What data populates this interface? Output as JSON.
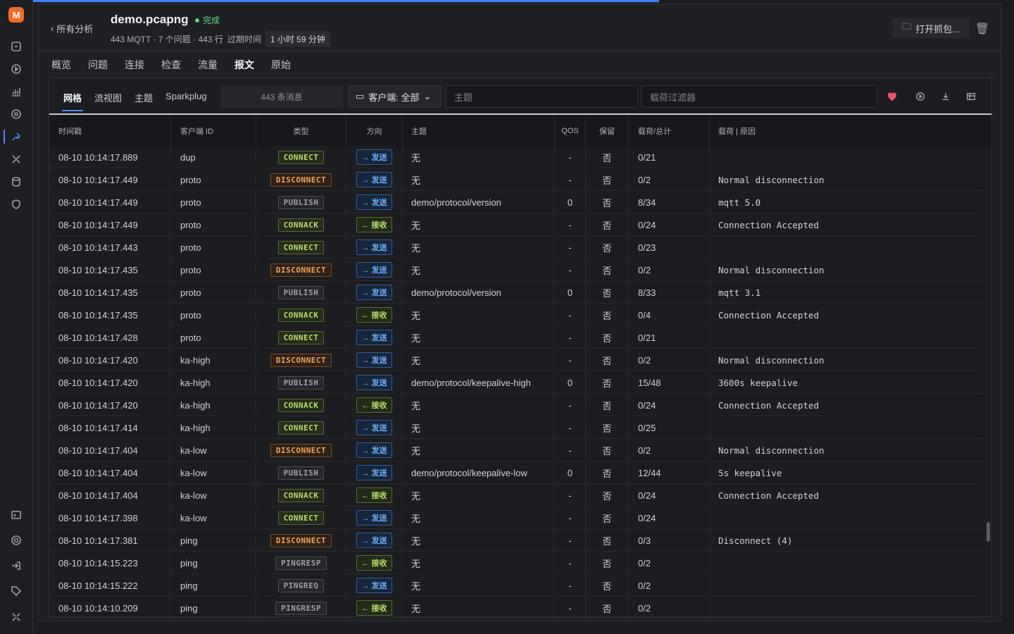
{
  "app": {
    "title": "demo.pcapng",
    "status": "完成",
    "back_label": "所有分析",
    "meta": "443 MQTT · 7 个问题 · 443 行",
    "expire_label": "过期时间",
    "expire_value": "1 小时 59 分钟",
    "open_button": "打开抓包..."
  },
  "tabs": [
    "概览",
    "问题",
    "连接",
    "检查",
    "流量",
    "报文",
    "原始"
  ],
  "active_tab": "报文",
  "subtabs": [
    "网格",
    "流视图",
    "主题",
    "Sparkplug"
  ],
  "toolbar": {
    "count": "443 条消息",
    "client_select": "客户端: 全部",
    "topic_placeholder": "主题",
    "payload_placeholder": "载荷过滤器"
  },
  "columns": {
    "ts": "时间戳",
    "cid": "客户端 ID",
    "type": "类型",
    "dir": "方向",
    "topic": "主题",
    "qos": "QOS",
    "ret": "保留",
    "pl": "载荷/总计",
    "reason": "载荷 | 原因"
  },
  "rows": [
    {
      "ts": "08-10 10:14:17.889",
      "cid": "dup",
      "type": "CONNECT",
      "dir": "发送",
      "topic": "无",
      "qos": "-",
      "ret": "否",
      "pl": "0/21",
      "reason": ""
    },
    {
      "ts": "08-10 10:14:17.449",
      "cid": "proto",
      "type": "DISCONNECT",
      "dir": "发送",
      "topic": "无",
      "qos": "-",
      "ret": "否",
      "pl": "0/2",
      "reason": "Normal disconnection"
    },
    {
      "ts": "08-10 10:14:17.449",
      "cid": "proto",
      "type": "PUBLISH",
      "dir": "发送",
      "topic": "demo/protocol/version",
      "qos": "0",
      "ret": "否",
      "pl": "8/34",
      "reason": "mqtt 5.0"
    },
    {
      "ts": "08-10 10:14:17.449",
      "cid": "proto",
      "type": "CONNACK",
      "dir": "接收",
      "topic": "无",
      "qos": "-",
      "ret": "否",
      "pl": "0/24",
      "reason": "Connection Accepted"
    },
    {
      "ts": "08-10 10:14:17.443",
      "cid": "proto",
      "type": "CONNECT",
      "dir": "发送",
      "topic": "无",
      "qos": "-",
      "ret": "否",
      "pl": "0/23",
      "reason": ""
    },
    {
      "ts": "08-10 10:14:17.435",
      "cid": "proto",
      "type": "DISCONNECT",
      "dir": "发送",
      "topic": "无",
      "qos": "-",
      "ret": "否",
      "pl": "0/2",
      "reason": "Normal disconnection"
    },
    {
      "ts": "08-10 10:14:17.435",
      "cid": "proto",
      "type": "PUBLISH",
      "dir": "发送",
      "topic": "demo/protocol/version",
      "qos": "0",
      "ret": "否",
      "pl": "8/33",
      "reason": "mqtt 3.1"
    },
    {
      "ts": "08-10 10:14:17.435",
      "cid": "proto",
      "type": "CONNACK",
      "dir": "接收",
      "topic": "无",
      "qos": "-",
      "ret": "否",
      "pl": "0/4",
      "reason": "Connection Accepted"
    },
    {
      "ts": "08-10 10:14:17.428",
      "cid": "proto",
      "type": "CONNECT",
      "dir": "发送",
      "topic": "无",
      "qos": "-",
      "ret": "否",
      "pl": "0/21",
      "reason": ""
    },
    {
      "ts": "08-10 10:14:17.420",
      "cid": "ka-high",
      "type": "DISCONNECT",
      "dir": "发送",
      "topic": "无",
      "qos": "-",
      "ret": "否",
      "pl": "0/2",
      "reason": "Normal disconnection"
    },
    {
      "ts": "08-10 10:14:17.420",
      "cid": "ka-high",
      "type": "PUBLISH",
      "dir": "发送",
      "topic": "demo/protocol/keepalive-high",
      "qos": "0",
      "ret": "否",
      "pl": "15/48",
      "reason": "3600s keepalive"
    },
    {
      "ts": "08-10 10:14:17.420",
      "cid": "ka-high",
      "type": "CONNACK",
      "dir": "接收",
      "topic": "无",
      "qos": "-",
      "ret": "否",
      "pl": "0/24",
      "reason": "Connection Accepted"
    },
    {
      "ts": "08-10 10:14:17.414",
      "cid": "ka-high",
      "type": "CONNECT",
      "dir": "发送",
      "topic": "无",
      "qos": "-",
      "ret": "否",
      "pl": "0/25",
      "reason": ""
    },
    {
      "ts": "08-10 10:14:17.404",
      "cid": "ka-low",
      "type": "DISCONNECT",
      "dir": "发送",
      "topic": "无",
      "qos": "-",
      "ret": "否",
      "pl": "0/2",
      "reason": "Normal disconnection"
    },
    {
      "ts": "08-10 10:14:17.404",
      "cid": "ka-low",
      "type": "PUBLISH",
      "dir": "发送",
      "topic": "demo/protocol/keepalive-low",
      "qos": "0",
      "ret": "否",
      "pl": "12/44",
      "reason": "5s keepalive"
    },
    {
      "ts": "08-10 10:14:17.404",
      "cid": "ka-low",
      "type": "CONNACK",
      "dir": "接收",
      "topic": "无",
      "qos": "-",
      "ret": "否",
      "pl": "0/24",
      "reason": "Connection Accepted"
    },
    {
      "ts": "08-10 10:14:17.398",
      "cid": "ka-low",
      "type": "CONNECT",
      "dir": "发送",
      "topic": "无",
      "qos": "-",
      "ret": "否",
      "pl": "0/24",
      "reason": ""
    },
    {
      "ts": "08-10 10:14:17.381",
      "cid": "ping",
      "type": "DISCONNECT",
      "dir": "发送",
      "topic": "无",
      "qos": "-",
      "ret": "否",
      "pl": "0/3",
      "reason": "Disconnect (4)"
    },
    {
      "ts": "08-10 10:14:15.223",
      "cid": "ping",
      "type": "PINGRESP",
      "dir": "接收",
      "topic": "无",
      "qos": "-",
      "ret": "否",
      "pl": "0/2",
      "reason": ""
    },
    {
      "ts": "08-10 10:14:15.222",
      "cid": "ping",
      "type": "PINGREQ",
      "dir": "发送",
      "topic": "无",
      "qos": "-",
      "ret": "否",
      "pl": "0/2",
      "reason": ""
    },
    {
      "ts": "08-10 10:14:10.209",
      "cid": "ping",
      "type": "PINGRESP",
      "dir": "接收",
      "topic": "无",
      "qos": "-",
      "ret": "否",
      "pl": "0/2",
      "reason": ""
    }
  ]
}
